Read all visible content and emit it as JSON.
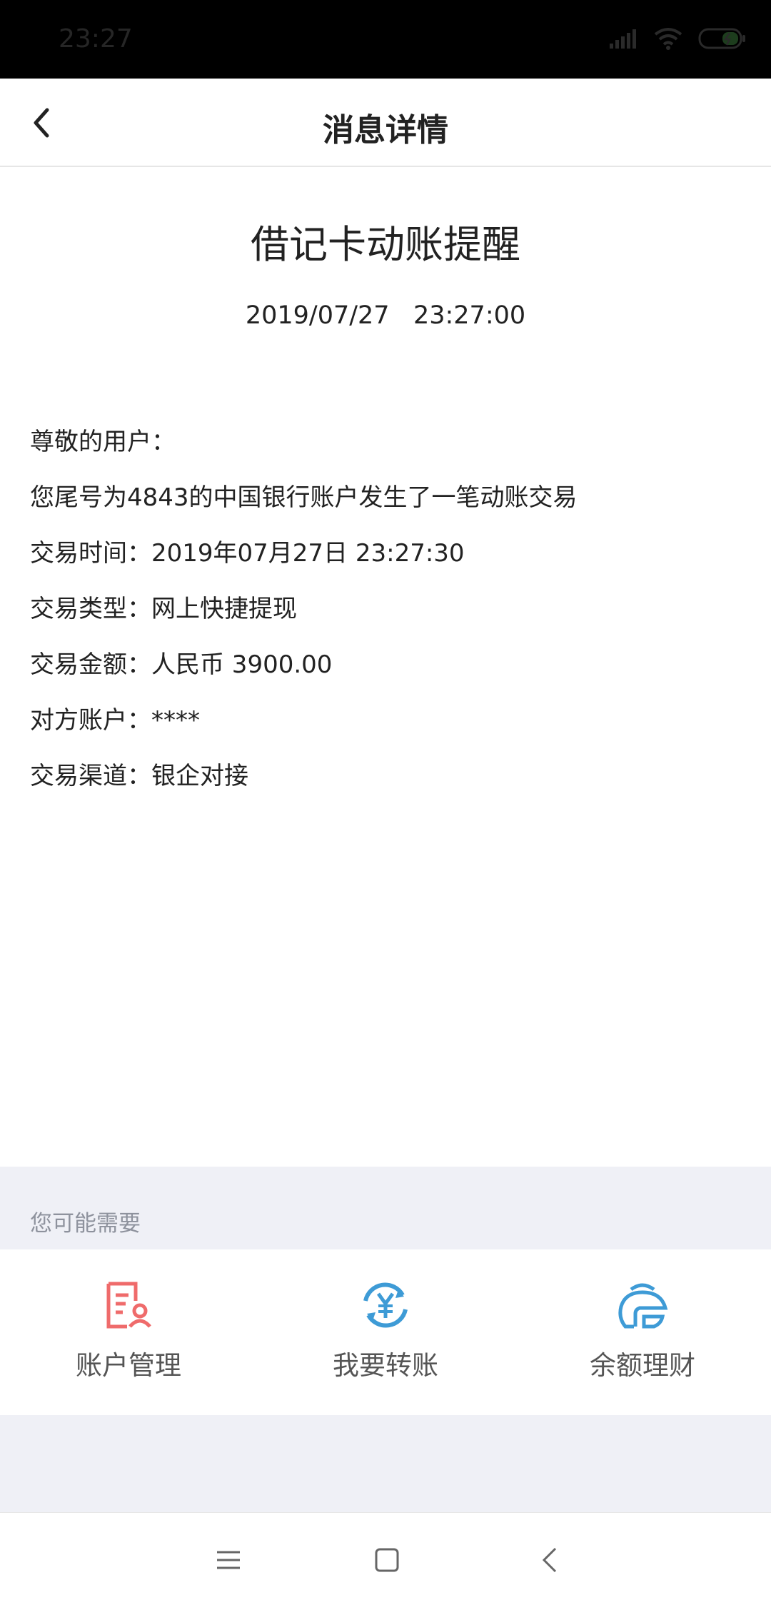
{
  "status_bar": {
    "time": "23:27"
  },
  "nav": {
    "title": "消息详情"
  },
  "message": {
    "title": "借记卡动账提醒",
    "datetime": "2019/07/27   23:27:00",
    "lines": [
      "尊敬的用户：",
      "您尾号为4843的中国银行账户发生了一笔动账交易",
      "交易时间：2019年07月27日 23:27:30",
      "交易类型：网上快捷提现",
      "交易金额：人民币 3900.00",
      "对方账户：****",
      "交易渠道：银企对接"
    ]
  },
  "suggest": {
    "label": "您可能需要"
  },
  "shortcuts": [
    {
      "label": "账户管理",
      "icon": "account-management-icon",
      "color": "#ef6b6b"
    },
    {
      "label": "我要转账",
      "icon": "transfer-icon",
      "color": "#3e9bd6"
    },
    {
      "label": "余额理财",
      "icon": "wealth-icon",
      "color": "#3e9bd6"
    }
  ],
  "system_nav": {
    "icons": [
      "menu-icon",
      "home-icon",
      "back-icon"
    ]
  }
}
